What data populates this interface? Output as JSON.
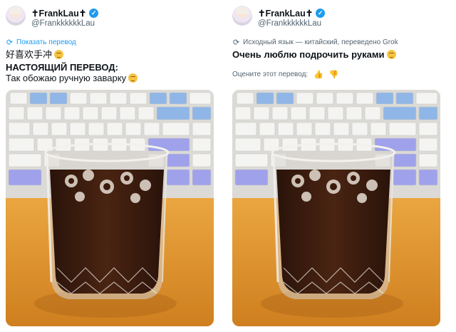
{
  "left": {
    "author": {
      "display_name": "✝FrankLau✝",
      "handle": "@FrankkkkkkLau"
    },
    "translate_link": "Показать перевод",
    "original_text": "好喜欢手冲",
    "heading": "НАСТОЯЩИЙ ПЕРЕВОД:",
    "translation": "Так обожаю ручную заварку"
  },
  "right": {
    "author": {
      "display_name": "✝FrankLau✝",
      "handle": "@FrankkkkkkLau"
    },
    "source_note": "Исходный язык — китайский, переведено Grok",
    "translation": "Очень люблю подрочить руками",
    "rate_prompt": "Оцените этот перевод:"
  },
  "icons": {
    "verified": "verified-badge-icon",
    "translate": "translate-icon",
    "emoji": "smirking-face-emoji",
    "thumbs_up": "thumbs-up-icon",
    "thumbs_down": "thumbs-down-icon"
  },
  "colors": {
    "link": "#1d9bf0",
    "muted": "#536471",
    "text": "#0f1419"
  }
}
